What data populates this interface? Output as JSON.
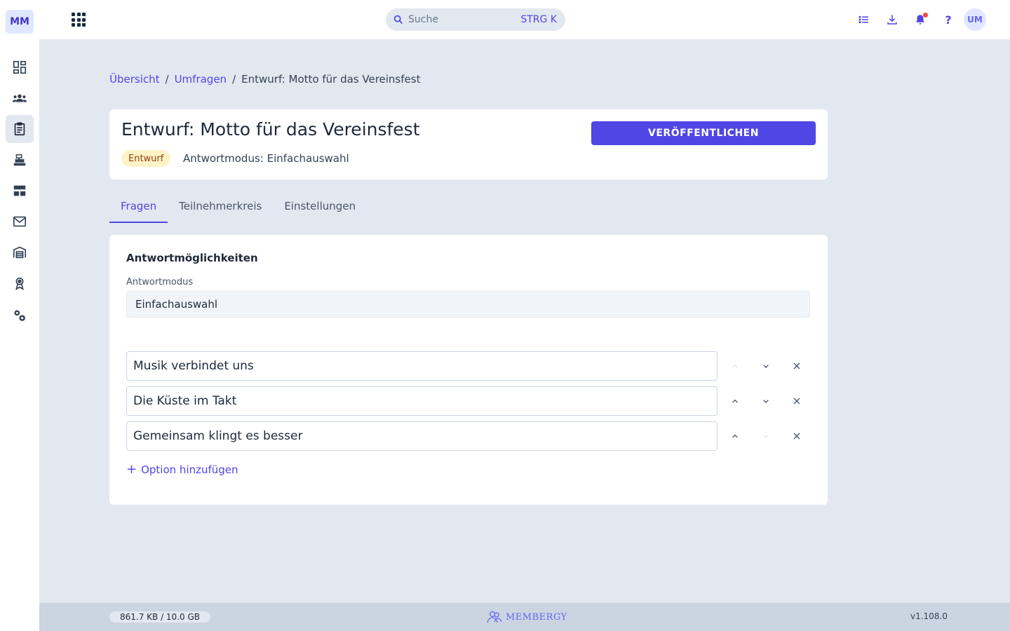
{
  "app": {
    "logo_text": "MM",
    "accent_color": "#4f46e5"
  },
  "sidebar": {
    "items": [
      {
        "icon": "dashboard-icon",
        "active": false
      },
      {
        "icon": "members-icon",
        "active": false
      },
      {
        "icon": "clipboard-icon",
        "active": true
      },
      {
        "icon": "cash-register-icon",
        "active": false
      },
      {
        "icon": "layout-icon",
        "active": false
      },
      {
        "icon": "mail-icon",
        "active": false
      },
      {
        "icon": "warehouse-icon",
        "active": false
      },
      {
        "icon": "award-icon",
        "active": false
      },
      {
        "icon": "settings-icon",
        "active": false
      }
    ]
  },
  "topbar": {
    "search_placeholder": "Suche",
    "search_shortcut": "STRG K",
    "help_label": "?",
    "avatar_initials": "UM"
  },
  "breadcrumb": {
    "items": [
      "Übersicht",
      "Umfragen"
    ],
    "separator": "/",
    "current": "Entwurf: Motto für das Vereinsfest"
  },
  "header": {
    "title": "Entwurf: Motto für das Vereinsfest",
    "status_badge": "Entwurf",
    "mode_label": "Antwortmodus:",
    "mode_value": "Einfachauswahl",
    "publish_label": "VERÖFFENTLICHEN"
  },
  "tabs": [
    {
      "label": "Fragen",
      "active": true
    },
    {
      "label": "Teilnehmerkreis",
      "active": false
    },
    {
      "label": "Einstellungen",
      "active": false
    }
  ],
  "answers": {
    "section_title": "Antwortmöglichkeiten",
    "mode_field_label": "Antwortmodus",
    "mode_field_value": "Einfachauswahl",
    "options": [
      {
        "value": "Musik verbindet uns",
        "up_enabled": false,
        "down_enabled": true
      },
      {
        "value": "Die Küste im Takt",
        "up_enabled": true,
        "down_enabled": true
      },
      {
        "value": "Gemeinsam klingt es besser",
        "up_enabled": true,
        "down_enabled": false
      }
    ],
    "add_option_label": "Option hinzufügen"
  },
  "footer": {
    "storage": "861.7 KB / 10.0 GB",
    "brand": "MEMBERGY",
    "version": "v1.108.0"
  }
}
